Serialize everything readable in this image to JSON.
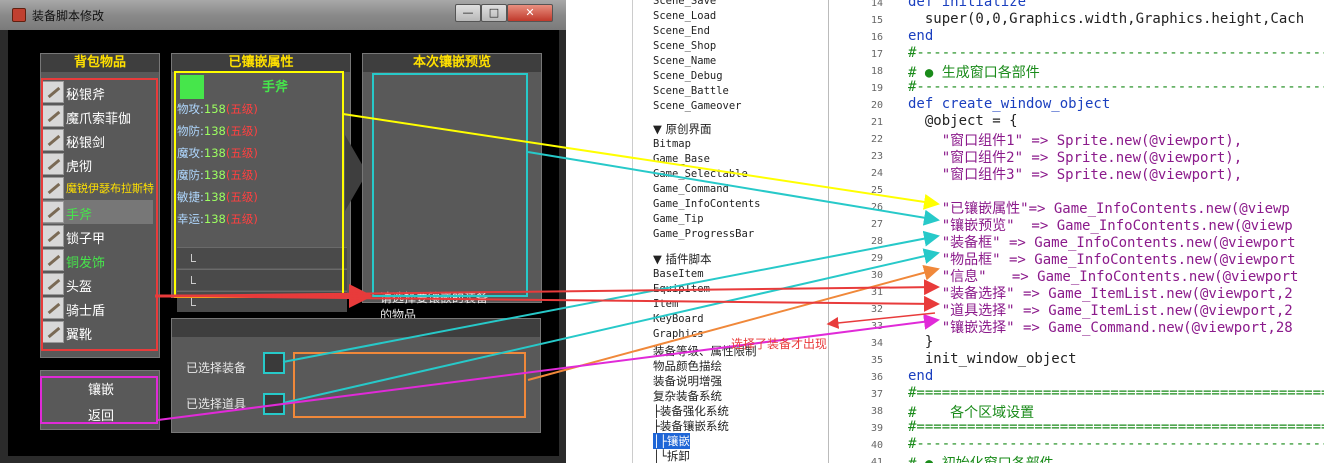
{
  "window": {
    "title": "装备脚本修改",
    "buttons": [
      "—",
      "□",
      "✕"
    ]
  },
  "panels": {
    "inventory_title": "背包物品",
    "attributes_title": "已镶嵌属性",
    "preview_title": "本次镶嵌预览"
  },
  "inventory": [
    {
      "name": "秘银斧",
      "color": "#ffffff"
    },
    {
      "name": "魔爪索菲伽",
      "color": "#ffffff"
    },
    {
      "name": "秘银剑",
      "color": "#ffffff"
    },
    {
      "name": "虎彻",
      "color": "#ffffff"
    },
    {
      "name": "魔锐伊瑟布拉斯特",
      "color": "#ffe000"
    },
    {
      "name": "手斧",
      "color": "#46e64b"
    },
    {
      "name": "锁子甲",
      "color": "#ffffff"
    },
    {
      "name": "铜发饰",
      "color": "#46e64b"
    },
    {
      "name": "头盔",
      "color": "#ffffff"
    },
    {
      "name": "骑士盾",
      "color": "#ffffff"
    },
    {
      "name": "翼靴",
      "color": "#ffffff"
    }
  ],
  "attributes": {
    "equip_name": "手斧",
    "stats": [
      {
        "label": "物攻:",
        "value": "158",
        "tag": "(五级)"
      },
      {
        "label": "物防:",
        "value": "138",
        "tag": "(五级)"
      },
      {
        "label": "魔攻:",
        "value": "138",
        "tag": "(五级)"
      },
      {
        "label": "魔防:",
        "value": "138",
        "tag": "(五级)"
      },
      {
        "label": "敏捷:",
        "value": "138",
        "tag": "(五级)"
      },
      {
        "label": "幸运:",
        "value": "138",
        "tag": "(五级)"
      }
    ]
  },
  "commands": [
    "镶嵌",
    "返回"
  ],
  "selection": {
    "equip_label": "已选择装备",
    "item_label": "已选择道具"
  },
  "tip_text": "请选择要镶嵌的装备",
  "tip_text2": "的物品",
  "annotation_note": "选择了装备才出现",
  "tree": {
    "scenes": [
      "Scene_Save",
      "Scene_Load",
      "Scene_End",
      "Scene_Shop",
      "Scene_Name",
      "Scene_Debug",
      "Scene_Battle",
      "Scene_Gameover"
    ],
    "group_original": "▼ 原创界面",
    "original_items": [
      "Bitmap",
      "Game_Base",
      "Game_Selectable",
      "Game_Command",
      "Game_InfoContents",
      "Game_Tip",
      "Game_ProgressBar"
    ],
    "group_plugins": "▼ 插件脚本",
    "plugin_items": [
      "BaseItem",
      "EquipItem",
      "Item",
      "KeyBoard",
      "Graphics"
    ],
    "extra_items": [
      "装备等级、属性限制",
      "物品颜色描绘",
      "装备说明增强",
      "复杂装备系统",
      "├装备强化系统",
      "├装备镶嵌系统",
      "│├镶嵌",
      "│└拆卸"
    ]
  },
  "code": {
    "lines": [
      {
        "n": "14",
        "t": "def initialize"
      },
      {
        "n": "15",
        "t": "  super(0,0,Graphics.width,Graphics.height,Cach"
      },
      {
        "n": "16",
        "t": "end"
      },
      {
        "n": "17",
        "t": "#-------------------------------------------------"
      },
      {
        "n": "18",
        "t": "# ● 生成窗口各部件"
      },
      {
        "n": "19",
        "t": "#-------------------------------------------------"
      },
      {
        "n": "20",
        "t": "def create_window_object"
      },
      {
        "n": "21",
        "t": "  @object = {"
      },
      {
        "n": "22",
        "t": "    \"窗口组件1\" => Sprite.new(@viewport),"
      },
      {
        "n": "23",
        "t": "    \"窗口组件2\" => Sprite.new(@viewport),"
      },
      {
        "n": "24",
        "t": "    \"窗口组件3\" => Sprite.new(@viewport),"
      },
      {
        "n": "25",
        "t": ""
      },
      {
        "n": "26",
        "t": "    \"已镶嵌属性\"=> Game_InfoContents.new(@viewp"
      },
      {
        "n": "27",
        "t": "    \"镶嵌预览\"  => Game_InfoContents.new(@viewp"
      },
      {
        "n": "28",
        "t": "    \"装备框\" => Game_InfoContents.new(@viewport"
      },
      {
        "n": "29",
        "t": "    \"物品框\" => Game_InfoContents.new(@viewport"
      },
      {
        "n": "30",
        "t": "    \"信息\"   => Game_InfoContents.new(@viewport"
      },
      {
        "n": "31",
        "t": "    \"装备选择\" => Game_ItemList.new(@viewport,2"
      },
      {
        "n": "32",
        "t": "    \"道具选择\" => Game_ItemList.new(@viewport,2"
      },
      {
        "n": "33",
        "t": "    \"镶嵌选择\" => Game_Command.new(@viewport,28"
      },
      {
        "n": "34",
        "t": "  }"
      },
      {
        "n": "35",
        "t": "  init_window_object"
      },
      {
        "n": "36",
        "t": "end"
      },
      {
        "n": "37",
        "t": "#================================================="
      },
      {
        "n": "38",
        "t": "#    各个区域设置"
      },
      {
        "n": "39",
        "t": "#================================================="
      },
      {
        "n": "40",
        "t": "#-------------------------------------------------"
      },
      {
        "n": "41",
        "t": "# ● 初始化窗口各部件"
      }
    ]
  },
  "colors": {
    "yellow": "#ffff00",
    "cyan": "#27c9c9",
    "orange": "#f0883a",
    "red": "#e83b3b",
    "magenta": "#e02ad8"
  }
}
